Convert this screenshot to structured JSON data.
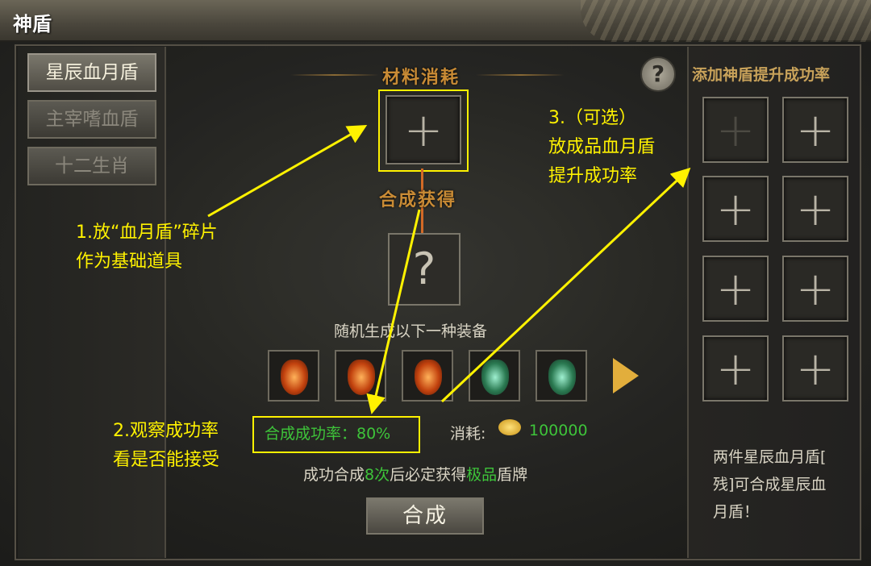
{
  "window": {
    "title": "神盾"
  },
  "tabs": [
    {
      "label": "星辰血月盾",
      "active": true
    },
    {
      "label": "主宰嗜血盾",
      "active": false
    },
    {
      "label": "十二生肖",
      "active": false
    }
  ],
  "main": {
    "material_title": "材料消耗",
    "result_title": "合成获得",
    "result_slot_glyph": "?",
    "help_glyph": "?",
    "random_text": "随机生成以下一种装备",
    "success_rate": "合成成功率：80%",
    "cost_label": "消耗:",
    "cost_value": "100000",
    "guarantee_prefix": "成功合成",
    "guarantee_count": "8次",
    "guarantee_mid": "后必定获得",
    "guarantee_item": "极品",
    "guarantee_suffix": "盾牌",
    "combine_button": "合成"
  },
  "sidebar": {
    "title": "添加神盾提升成功率",
    "note": [
      "两件星辰血月盾[",
      "残]可合成星辰血",
      "月盾！"
    ]
  },
  "annotations": {
    "step1": [
      "1.放“血月盾”碎片",
      "作为基础道具"
    ],
    "step2": [
      "2.观察成功率",
      "看是否能接受"
    ],
    "step3": [
      "3.（可选）",
      "放成品血月盾",
      "提升成功率"
    ]
  },
  "colors": {
    "annotation": "#fff200",
    "success": "#3ec43a",
    "gold_title": "#c98b35",
    "accent_line": "#d36a26"
  },
  "icons": {
    "add_slot": "plus-icon",
    "next": "arrow-right-icon",
    "coin": "gold-coin-icon",
    "help": "question-icon"
  }
}
